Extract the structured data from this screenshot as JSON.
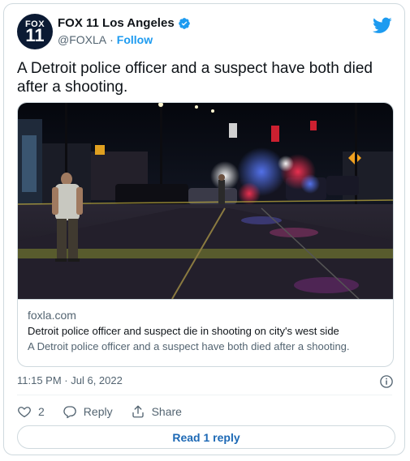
{
  "account": {
    "avatar_top": "FOX",
    "avatar_number": "11",
    "display_name": "FOX 11 Los Angeles",
    "handle": "@FOXLA",
    "separator": "·",
    "follow_label": "Follow"
  },
  "tweet": {
    "text": "A Detroit police officer and a suspect have both died after a shooting."
  },
  "link_card": {
    "domain": "foxla.com",
    "title": "Detroit police officer and suspect die in shooting on city's west side",
    "description": "A Detroit police officer and a suspect have both died after a shooting."
  },
  "timestamp": "11:15 PM · Jul 6, 2022",
  "actions": {
    "like_count": "2",
    "reply_label": "Reply",
    "share_label": "Share"
  },
  "read_replies_label": "Read 1 reply",
  "colors": {
    "twitter_blue": "#1d9bf0",
    "read_button_text": "#1d69b5",
    "secondary_text": "#536471",
    "border": "#cfd9de"
  },
  "icons": [
    "verified-badge-icon",
    "twitter-bird-icon",
    "info-icon",
    "heart-icon",
    "reply-icon",
    "share-icon"
  ]
}
